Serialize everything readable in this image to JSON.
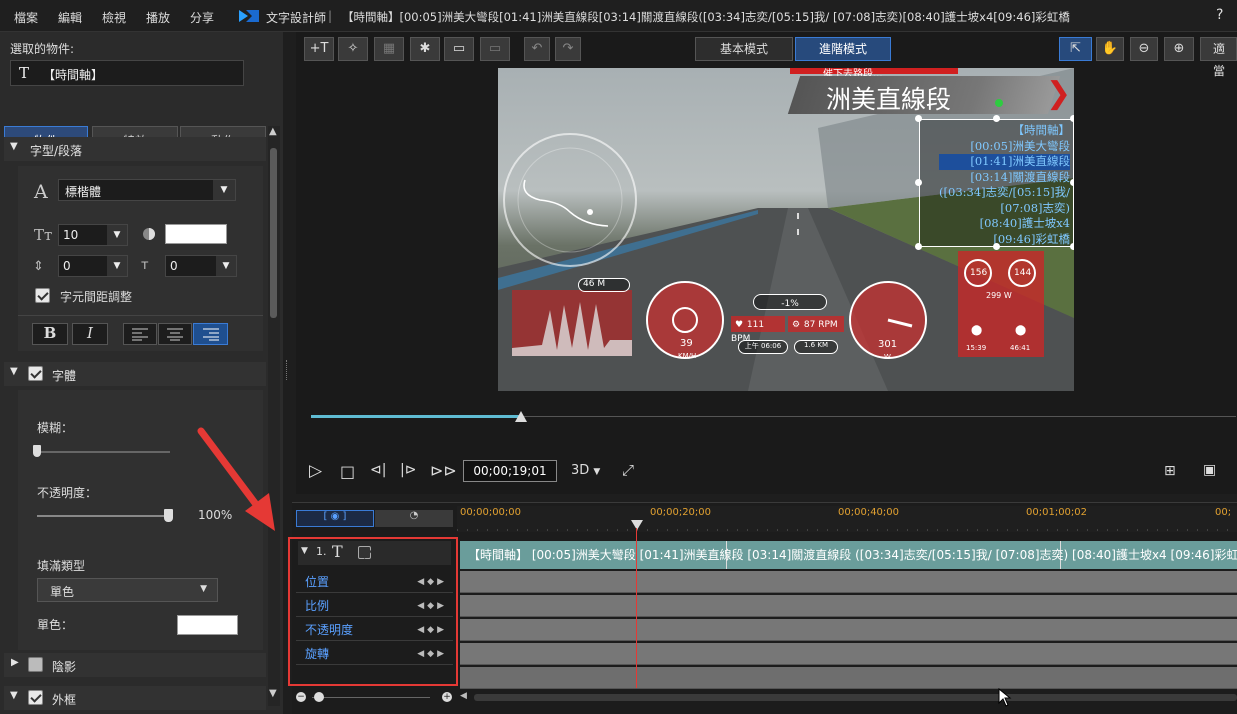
{
  "menubar": {
    "items": [
      "檔案",
      "編輯",
      "檢視",
      "播放",
      "分享"
    ],
    "app_name": "文字設計師",
    "title": "【時間軸】[00:05]洲美大彎段[01:41]洲美直線段[03:14]關渡直線段([03:34]志奕/[05:15]我/ [07:08]志奕)[08:40]護士坡x4[09:46]彩虹橋",
    "help": "?"
  },
  "left": {
    "selected_label": "選取的物件:",
    "selected_object": "【時間軸】",
    "tabs": [
      "物件",
      "特效",
      "動作"
    ],
    "font_section": "字型/段落",
    "font_name": "標楷體",
    "font_size": "10",
    "line_spacing": "0",
    "char_spacing": "0",
    "kerning_label": "字元間距調整",
    "bold": "B",
    "italic": "I",
    "text_section": "字體",
    "blur_label": "模糊：",
    "opacity_label": "不透明度：",
    "opacity_value": "100%",
    "fill_type_label": "填滿類型",
    "fill_type_value": "單色",
    "solid_label": "單色：",
    "shadow_section": "陰影",
    "border_section": "外框",
    "scroll_up": "▲",
    "scroll_down": "▼"
  },
  "toolbar": {
    "basic_mode": "基本模式",
    "advanced_mode": "進階模式",
    "fit": "適當"
  },
  "video": {
    "banner_small": "催下去路段...",
    "banner_title": "洲美直線段",
    "overlay_lines": [
      "【時間軸】",
      "[00:05]洲美大彎段",
      "[01:41]洲美直線段",
      "[03:14]關渡直線段",
      "([03:34]志奕/[05:15]我/",
      "[07:08]志奕)",
      "[08:40]護士坡x4",
      "[09:46]彩虹橋"
    ],
    "speed": "39",
    "speed_unit": "KM/H",
    "power": "301",
    "power_unit": "W",
    "heart": "111 BPM",
    "cadence": "87 RPM",
    "grade": "-1%",
    "dist": "1.6 KM",
    "time": "上午 06:06",
    "hr_left": "156",
    "hr_right": "144",
    "watts": "299 W",
    "t_left": "15:39",
    "t_right": "46:41",
    "alt": "46 M"
  },
  "playback": {
    "timecode": "00;00;19;01",
    "mode_3d": "3D"
  },
  "timeline": {
    "ruler": [
      "00;00;00;00",
      "00;00;20;00",
      "00;00;40;00",
      "00;01;00;02",
      "00;"
    ],
    "track_index": "1.",
    "clip_text": "【時間軸】 [00:05]洲美大彎段 [01:41]洲美直線段 [03:14]關渡直線段 ([03:34]志奕/[05:15]我/ [07:08]志奕) [08:40]護士坡x4 [09:46]彩虹橋",
    "properties": [
      "位置",
      "比例",
      "不透明度",
      "旋轉"
    ]
  },
  "colors": {
    "accent": "#3a7bd5",
    "highlight_red": "#e53935",
    "timeline_cyan": "#5fbcd3"
  }
}
